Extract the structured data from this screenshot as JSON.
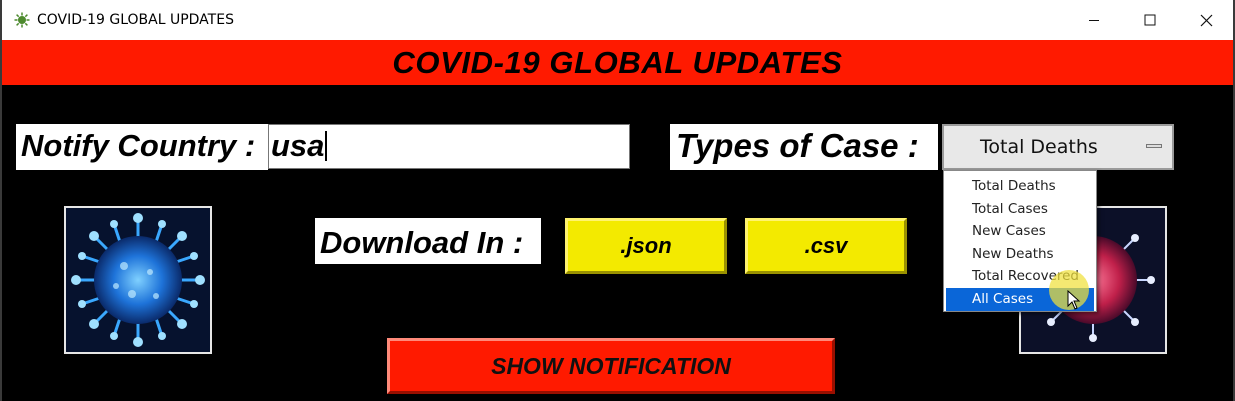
{
  "window": {
    "title": "COVID-19 GLOBAL UPDATES",
    "controls": {
      "minimize": "minimize-icon",
      "maximize": "maximize-icon",
      "close": "close-icon"
    }
  },
  "banner": {
    "title": "COVID-19 GLOBAL UPDATES"
  },
  "notify": {
    "label": "Notify Country :",
    "value": "usa"
  },
  "case_type": {
    "label": "Types of Case :",
    "selected": "Total Deaths",
    "options": [
      "Total Deaths",
      "Total Cases",
      "New Cases",
      "New Deaths",
      "Total Recovered",
      "All Cases"
    ],
    "highlighted": "All Cases"
  },
  "download": {
    "label": "Download In :",
    "json_label": ".json",
    "csv_label": ".csv"
  },
  "show_notification": {
    "label": "SHOW NOTIFICATION"
  },
  "colors": {
    "banner": "#ff1a00",
    "button_yellow": "#f3ea00",
    "background": "#000000",
    "highlight": "#0a66d8"
  },
  "icons": {
    "app": "virus-icon",
    "images": [
      "virus-image-blue",
      "virus-image-red"
    ],
    "cursor": "mouse-pointer-icon"
  }
}
